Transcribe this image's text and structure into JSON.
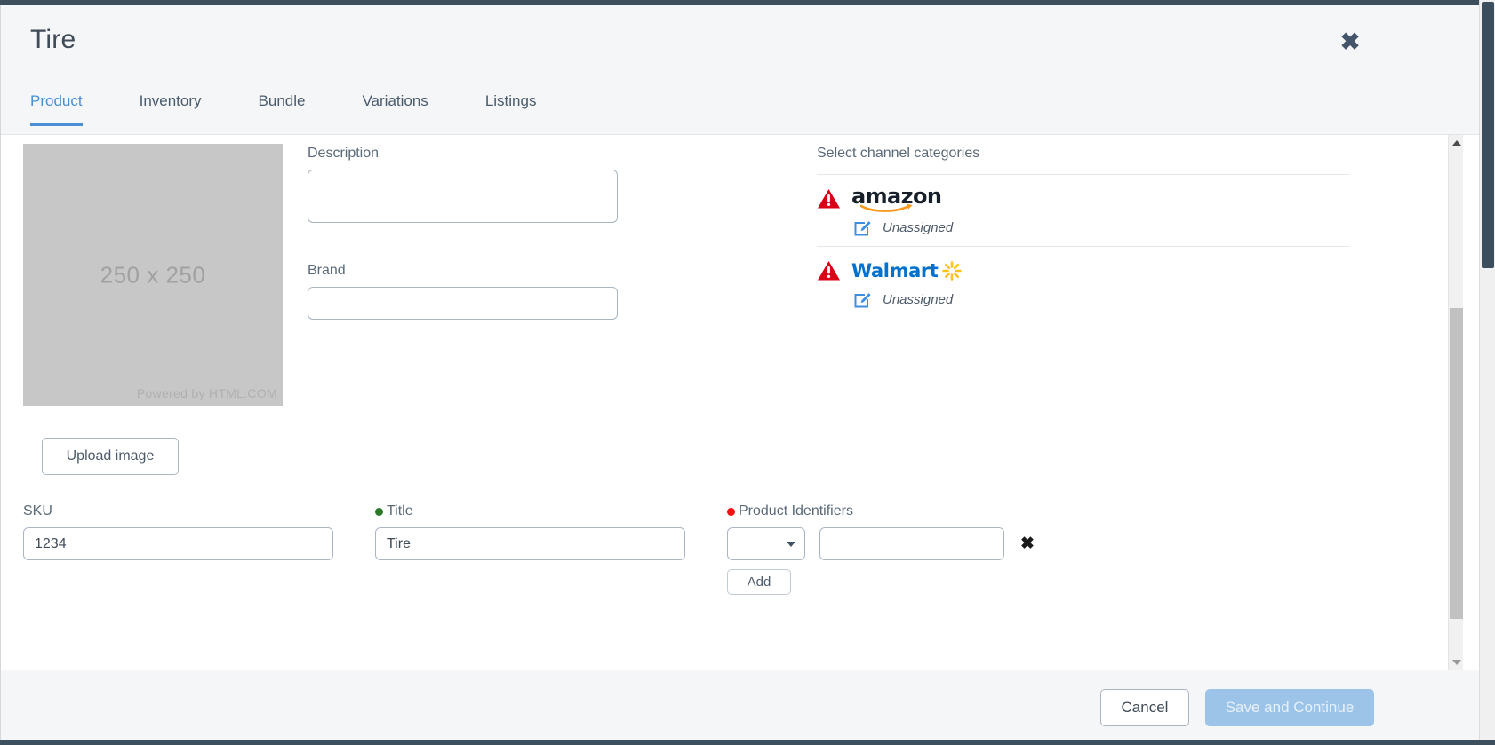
{
  "window": {
    "title": "Tire",
    "close_icon": "close-icon"
  },
  "tabs": [
    {
      "label": "Product",
      "active": true
    },
    {
      "label": "Inventory",
      "active": false
    },
    {
      "label": "Bundle",
      "active": false
    },
    {
      "label": "Variations",
      "active": false
    },
    {
      "label": "Listings",
      "active": false
    }
  ],
  "image": {
    "placeholder_label": "250 x 250",
    "credit": "Powered by HTML.COM",
    "upload_button": "Upload image"
  },
  "fields": {
    "description_label": "Description",
    "description_value": "",
    "description_placeholder": "",
    "brand_label": "Brand",
    "brand_value": "",
    "brand_placeholder": "",
    "sku_label": "SKU",
    "sku_value": "1234",
    "title_label": "Title",
    "title_value": "Tire",
    "product_identifiers_label": "Product Identifiers",
    "identifier_type_value": "",
    "identifier_value": "",
    "remove_identifier_icon": "✖",
    "add_button": "Add"
  },
  "channels": {
    "heading": "Select channel categories",
    "items": [
      {
        "name": "amazon",
        "status": "Unassigned",
        "warning": true,
        "edit_icon": "edit-icon"
      },
      {
        "name": "Walmart",
        "status": "Unassigned",
        "warning": true,
        "edit_icon": "edit-icon"
      }
    ]
  },
  "footer": {
    "cancel_label": "Cancel",
    "save_label": "Save and Continue"
  },
  "colors": {
    "accent": "#4a8fd4",
    "warning": "#d70015",
    "amazon_swoosh": "#f8991d",
    "walmart_blue": "#0071ce",
    "walmart_spark": "#ffc220",
    "required_red": "#f51010",
    "optional_green": "#2a7a2a",
    "save_disabled": "#9cc3e8"
  }
}
